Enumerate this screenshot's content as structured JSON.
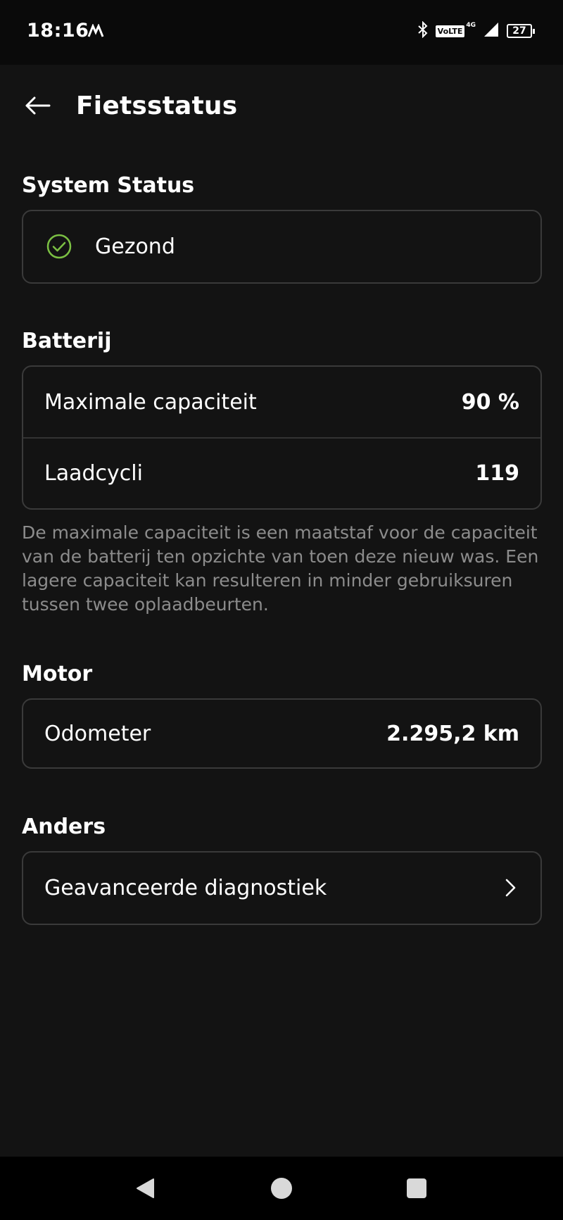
{
  "statusbar": {
    "time": "18:16",
    "volte": "VoLTE",
    "network": "4G",
    "battery": "27"
  },
  "appbar": {
    "title": "Fietsstatus"
  },
  "system_status": {
    "heading": "System Status",
    "status": "Gezond",
    "status_color": "#7bc043"
  },
  "battery": {
    "heading": "Batterij",
    "rows": [
      {
        "label": "Maximale capaciteit",
        "value": "90 %"
      },
      {
        "label": "Laadcycli",
        "value": "119"
      }
    ],
    "note": "De maximale capaciteit is een maatstaf voor de capaciteit van de batterij ten opzichte van toen deze nieuw was. Een lagere capaciteit kan resulteren in minder gebruiksuren tussen twee oplaadbeurten."
  },
  "motor": {
    "heading": "Motor",
    "rows": [
      {
        "label": "Odometer",
        "value": "2.295,2 km"
      }
    ]
  },
  "other": {
    "heading": "Anders",
    "item_label": "Geavanceerde diagnostiek"
  },
  "icons": {
    "back": "arrow-left-icon",
    "status": "check-circle-icon",
    "chevron": "chevron-right-icon",
    "nav_back": "triangle-back-icon",
    "nav_home": "circle-home-icon",
    "nav_recents": "square-recents-icon"
  }
}
